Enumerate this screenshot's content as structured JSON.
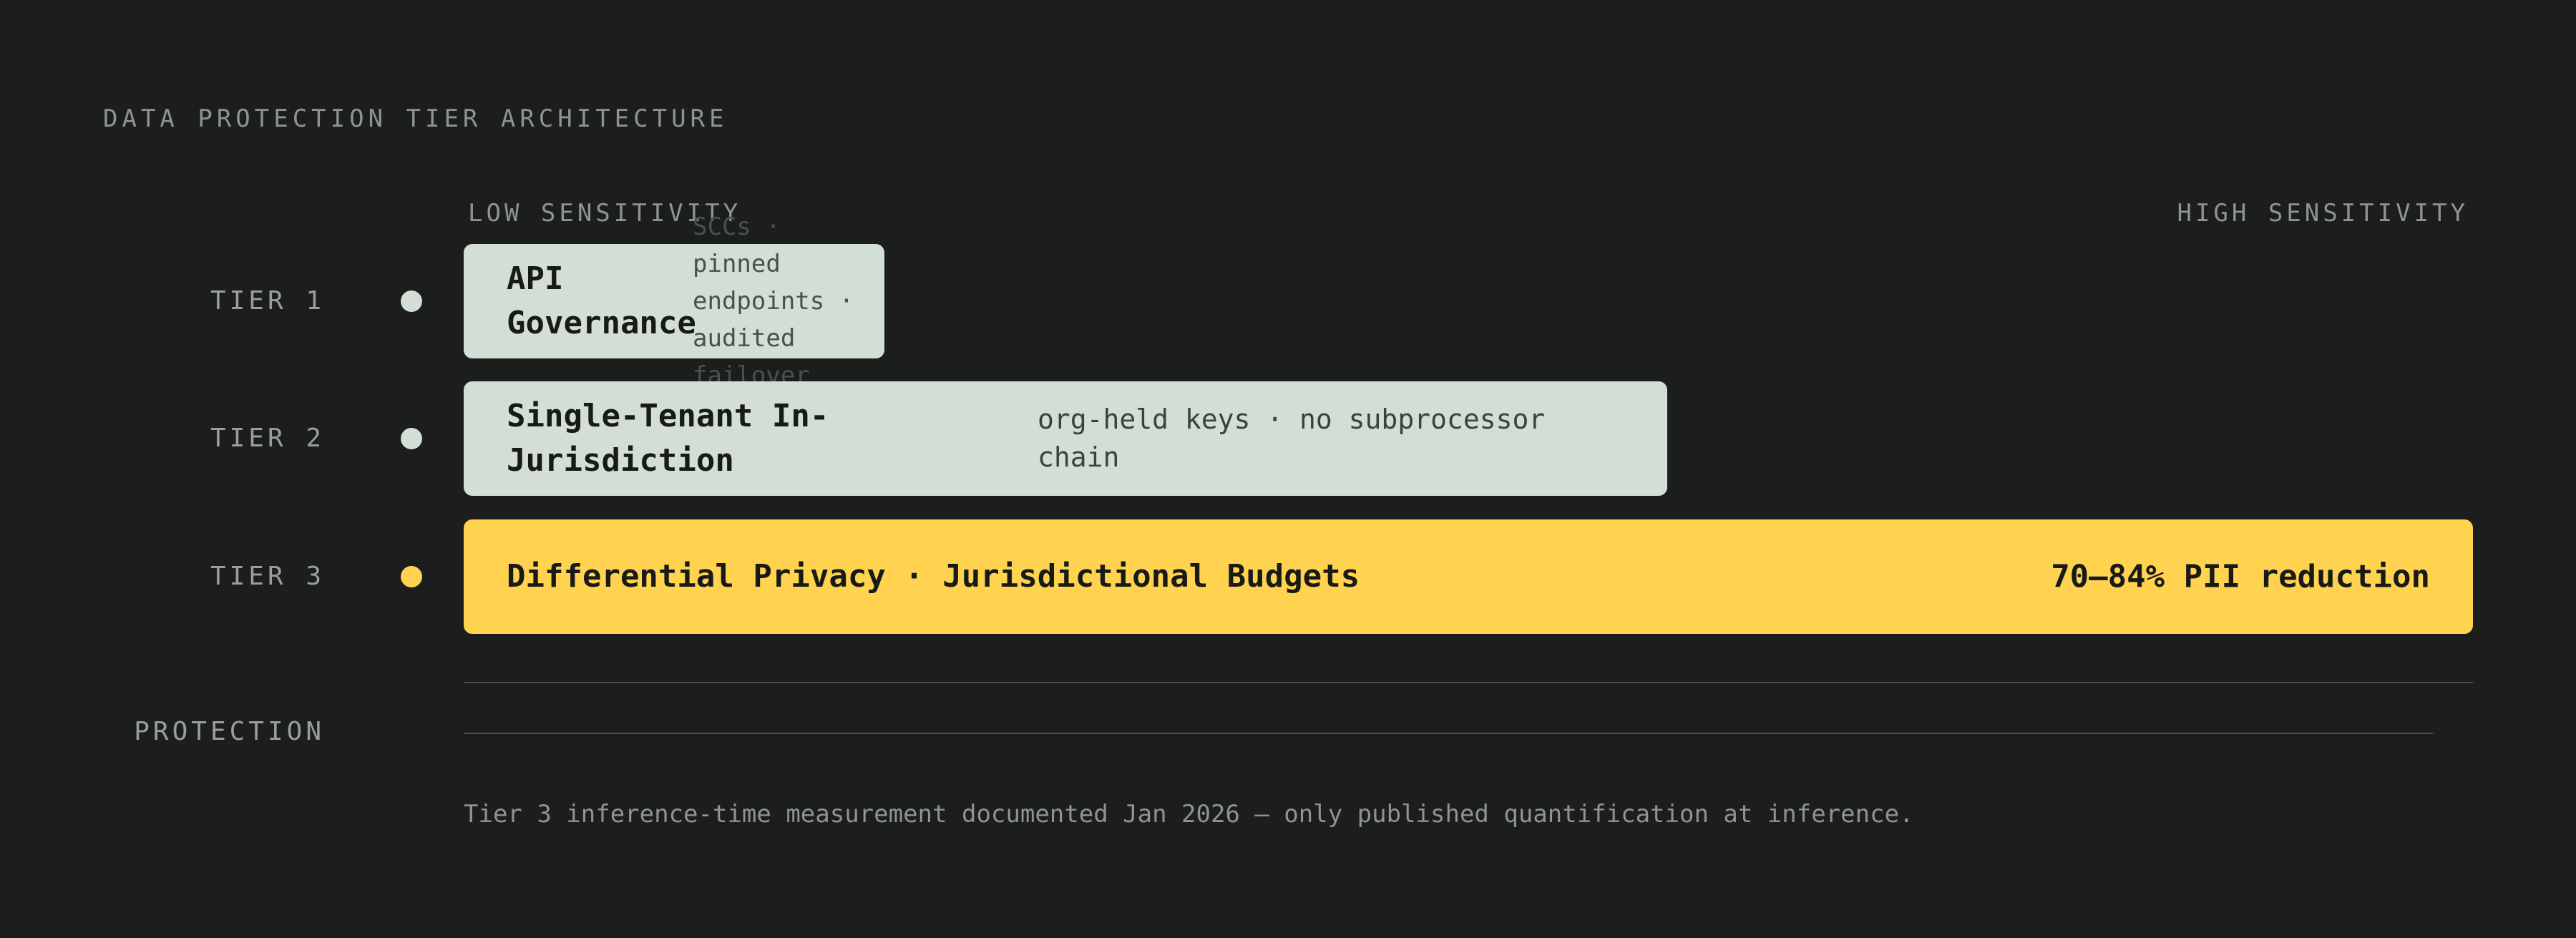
{
  "title": "DATA PROTECTION TIER ARCHITECTURE",
  "axis": {
    "low": "LOW SENSITIVITY",
    "high": "HIGH SENSITIVITY"
  },
  "tiers": [
    {
      "label": "TIER 1",
      "name": "API Governance",
      "detail": "SCCs · pinned endpoints · audited failover",
      "dot_color": "#d3dfd5",
      "bar_color": "#d3dfd5"
    },
    {
      "label": "TIER 2",
      "name": "Single-Tenant In-Jurisdiction",
      "detail": "org-held keys · no subprocessor chain",
      "dot_color": "#d3dfd5",
      "bar_color": "#d3dfd5"
    },
    {
      "label": "TIER 3",
      "name": "Differential Privacy · Jurisdictional Budgets",
      "metric": "70–84% PII reduction",
      "dot_color": "#ffd34f",
      "bar_color": "#ffd34f"
    }
  ],
  "protection_label": "PROTECTION",
  "footnote": "Tier 3 inference-time measurement documented Jan 2026 — only published quantification at inference."
}
